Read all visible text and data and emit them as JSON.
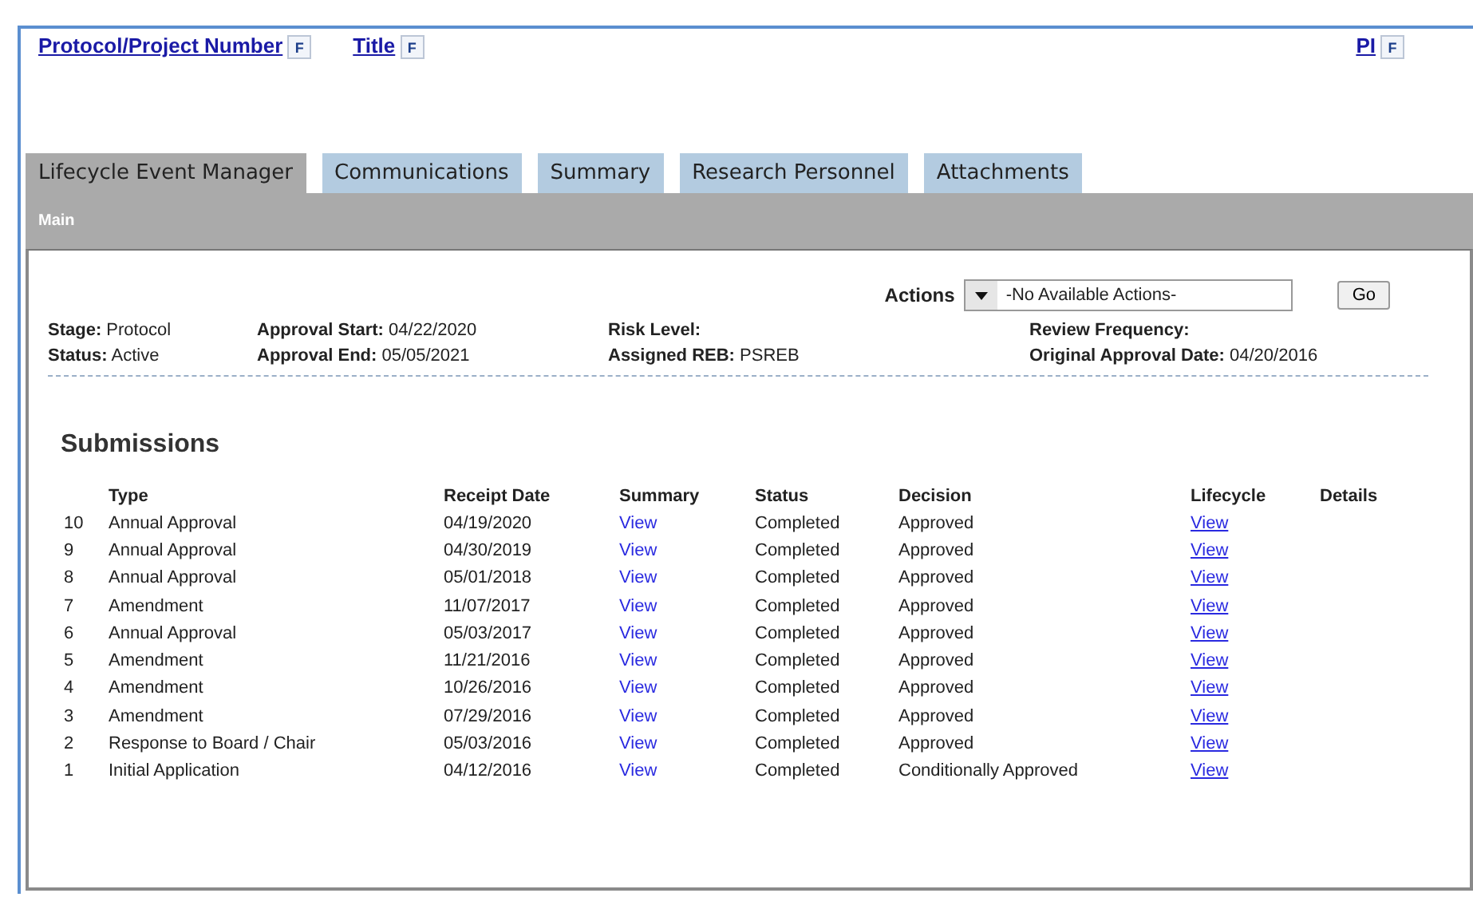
{
  "header_links": [
    {
      "label": "Protocol/Project Number",
      "filter": "F"
    },
    {
      "label": "Title",
      "filter": "F"
    },
    {
      "label": "PI",
      "filter": "F"
    }
  ],
  "tabs": [
    {
      "label": "Lifecycle Event Manager",
      "selected": true
    },
    {
      "label": "Communications",
      "selected": false
    },
    {
      "label": "Summary",
      "selected": false
    },
    {
      "label": "Research Personnel",
      "selected": false
    },
    {
      "label": "Attachments",
      "selected": false
    }
  ],
  "sub_bar": "Main",
  "actions": {
    "label": "Actions",
    "value": "-No Available Actions-",
    "go": "Go"
  },
  "info": [
    [
      {
        "label": "Stage:",
        "value": "Protocol"
      },
      {
        "label": "Status:",
        "value": "Active"
      }
    ],
    [
      {
        "label": "Approval Start:",
        "value": "04/22/2020"
      },
      {
        "label": "Approval End:",
        "value": "05/05/2021"
      }
    ],
    [
      {
        "label": "Risk Level:"
      },
      {
        "label": "Assigned REB:",
        "value": "PSREB"
      }
    ],
    [
      {
        "label": "Review Frequency:"
      },
      {
        "label": "Original Approval Date:",
        "value": "04/20/2016"
      }
    ]
  ],
  "submissions": {
    "title": "Submissions",
    "columns": [
      "Type",
      "Receipt Date",
      "Summary",
      "Status",
      "Decision",
      "Lifecycle",
      "Details"
    ],
    "rows": [
      {
        "number": "10",
        "type": "Annual Approval",
        "receipt_date": "04/19/2020",
        "summary": "View",
        "status": "Completed",
        "decision": "Approved",
        "lifecycle": "View"
      },
      {
        "number": "9",
        "type": "Annual Approval",
        "receipt_date": "04/30/2019",
        "summary": "View",
        "status": "Completed",
        "decision": "Approved",
        "lifecycle": "View"
      },
      {
        "number": "8",
        "type": "Annual Approval",
        "receipt_date": "05/01/2018",
        "summary": "View",
        "status": "Completed",
        "decision": "Approved",
        "lifecycle": "View"
      },
      {
        "number": "7",
        "type": "Amendment",
        "receipt_date": "11/07/2017",
        "summary": "View",
        "status": "Completed",
        "decision": "Approved",
        "lifecycle": "View"
      },
      {
        "number": "6",
        "type": "Annual Approval",
        "receipt_date": "05/03/2017",
        "summary": "View",
        "status": "Completed",
        "decision": "Approved",
        "lifecycle": "View"
      },
      {
        "number": "5",
        "type": "Amendment",
        "receipt_date": "11/21/2016",
        "summary": "View",
        "status": "Completed",
        "decision": "Approved",
        "lifecycle": "View"
      },
      {
        "number": "4",
        "type": "Amendment",
        "receipt_date": "10/26/2016",
        "summary": "View",
        "status": "Completed",
        "decision": "Approved",
        "lifecycle": "View"
      },
      {
        "number": "3",
        "type": "Amendment",
        "receipt_date": "07/29/2016",
        "summary": "View",
        "status": "Completed",
        "decision": "Approved",
        "lifecycle": "View"
      },
      {
        "number": "2",
        "type": "Response to Board / Chair",
        "receipt_date": "05/03/2016",
        "summary": "View",
        "status": "Completed",
        "decision": "Approved",
        "lifecycle": "View"
      },
      {
        "number": "1",
        "type": "Initial Application",
        "receipt_date": "04/12/2016",
        "summary": "View",
        "status": "Completed",
        "decision": "Conditionally Approved",
        "lifecycle": "View"
      }
    ]
  }
}
